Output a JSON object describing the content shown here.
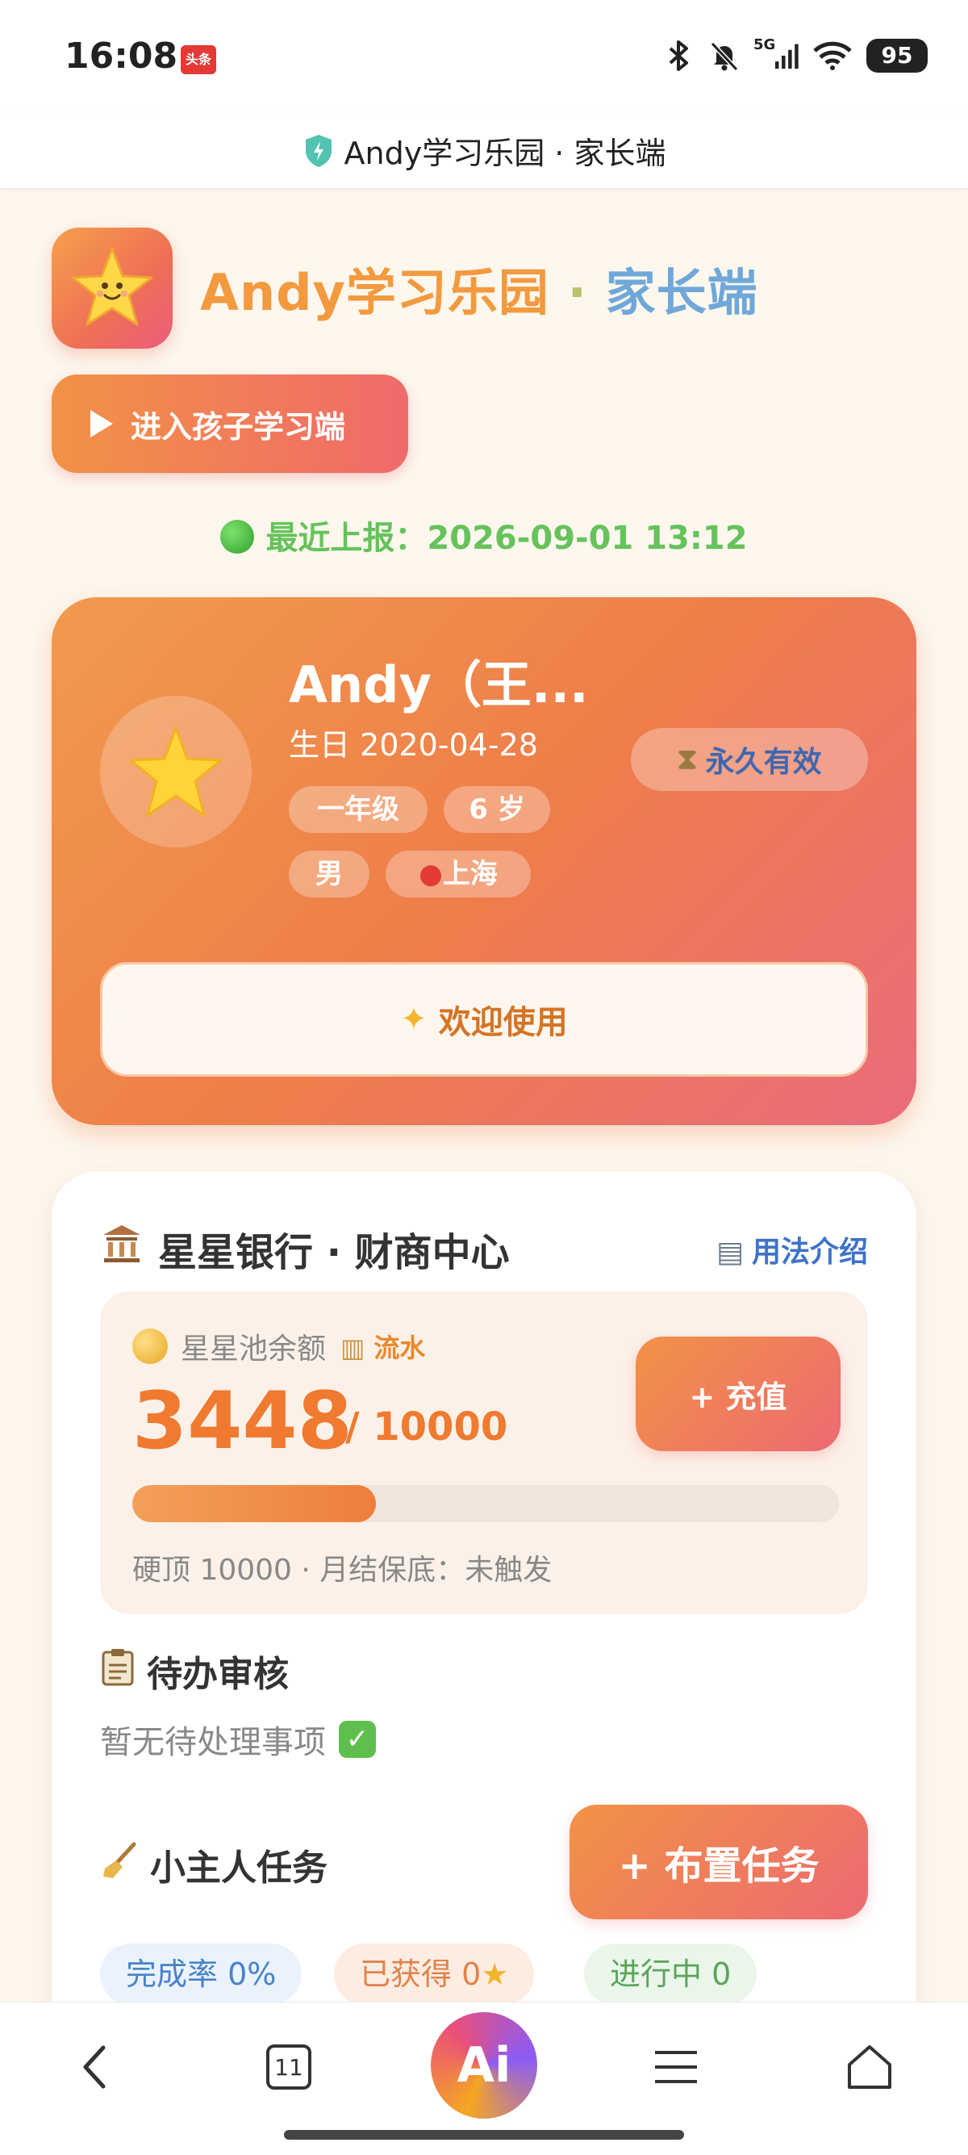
{
  "status_bar": {
    "time": "16:08",
    "app_badge": "头条",
    "network": "5G",
    "battery": "95"
  },
  "browser": {
    "title": "Andy学习乐园 · 家长端"
  },
  "header": {
    "title_part1": "Andy学习乐园",
    "title_sep": " · ",
    "title_part2": "家长端",
    "enter_button": "进入孩子学习端"
  },
  "report": {
    "text": "最近上报：2026-09-01 13:12"
  },
  "profile": {
    "name": "Andy（王...",
    "birthday": "生日 2020-04-28",
    "tags": [
      "一年级",
      "6 岁",
      "男",
      "上海"
    ],
    "validity": "永久有效",
    "welcome": "欢迎使用"
  },
  "bank": {
    "title": "星星银行 · 财商中心",
    "usage_link": "用法介绍",
    "pool_label": "星星池余额",
    "flow_link": "流水",
    "balance": "3448",
    "max": "/ 10000",
    "progress_percent": 34.48,
    "recharge_button": "+ 充值",
    "note": "硬顶 10000 · 月结保底：未触发"
  },
  "pending": {
    "title": "待办审核",
    "empty_text": "暂无待处理事项"
  },
  "tasks": {
    "title": "小主人任务",
    "assign_button": "+ 布置任务",
    "stats": {
      "completion": "完成率 0%",
      "earned": "已获得 0",
      "in_progress": "进行中 0"
    }
  },
  "nav": {
    "tabs_count": "11",
    "ai_label": "Ai"
  },
  "colors": {
    "accent_orange": "#ef7a30",
    "accent_pink": "#ec6a72",
    "report_green": "#66c25b",
    "link_blue": "#3f73c8"
  }
}
